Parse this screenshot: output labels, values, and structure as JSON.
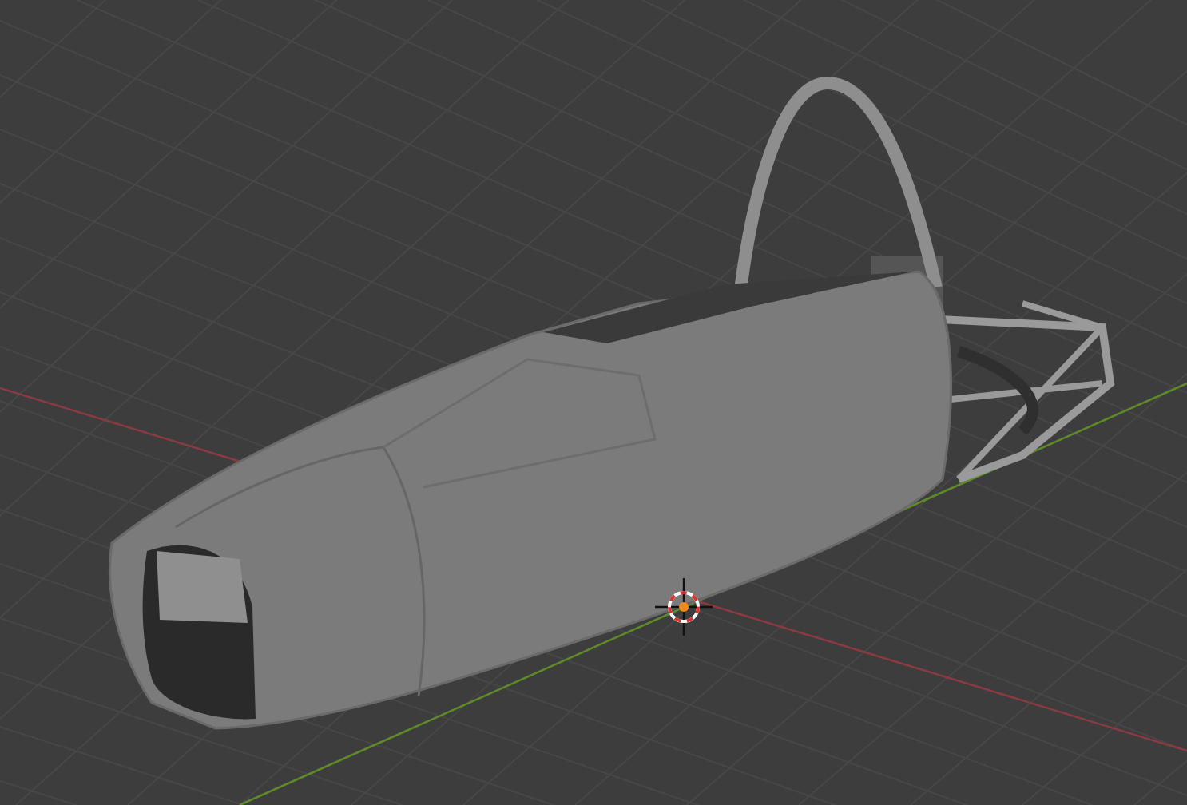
{
  "viewport": {
    "show_grid": true,
    "show_3d_cursor": true
  }
}
